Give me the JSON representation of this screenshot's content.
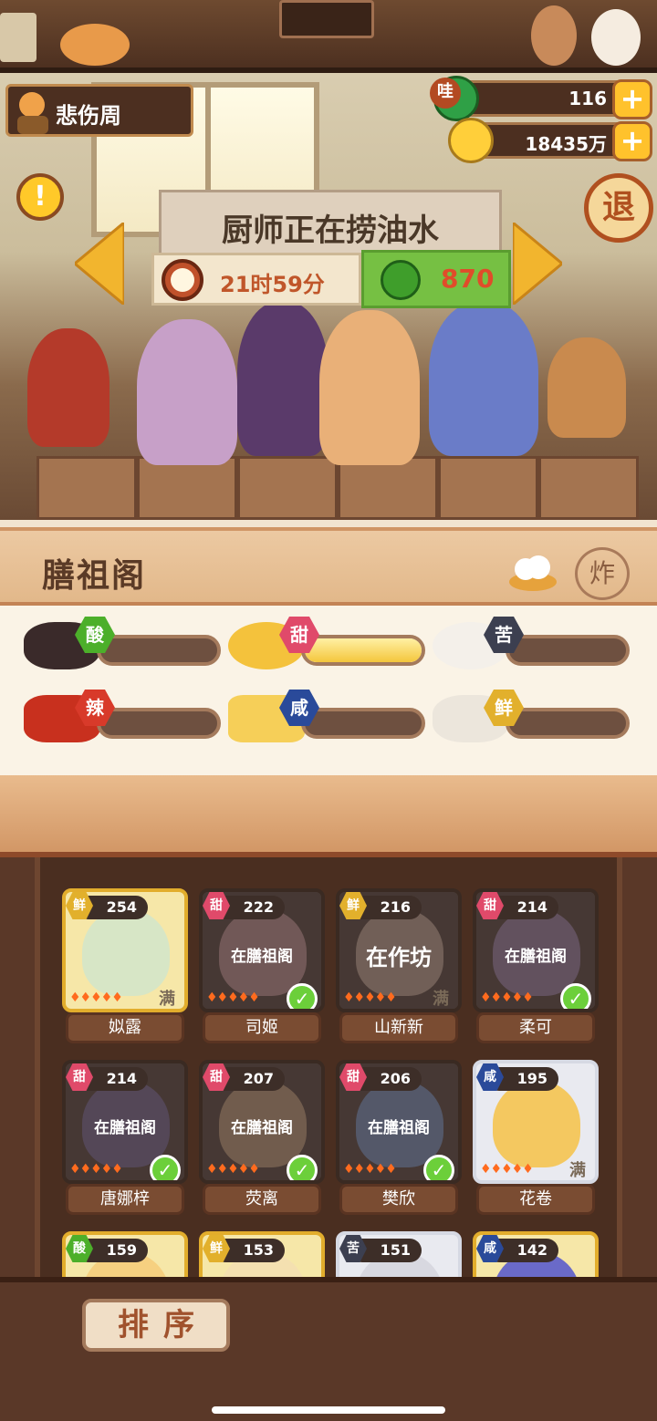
{
  "player": {
    "name": "悲伤周"
  },
  "currency": {
    "gems": "116",
    "gem_badge": "哇",
    "coins": "18435万",
    "plus": "+"
  },
  "buttons": {
    "alert": "!",
    "exit": "退",
    "blast": "炸",
    "sort": "排序"
  },
  "status": {
    "text": "厨师正在捞油水",
    "timer": "21时59分",
    "cost": "870"
  },
  "pavilion": {
    "title": "膳祖阁",
    "flavors": [
      {
        "label": "酸",
        "color": "#4caf2a",
        "fill": 0
      },
      {
        "label": "甜",
        "color": "#e04a6a",
        "fill": 1
      },
      {
        "label": "苦",
        "color": "#3c3f50",
        "fill": 0
      },
      {
        "label": "辣",
        "color": "#d83a2a",
        "fill": 0
      },
      {
        "label": "咸",
        "color": "#2a4a9a",
        "fill": 0
      },
      {
        "label": "鲜",
        "color": "#e2b02c",
        "fill": 0
      }
    ]
  },
  "chefs": [
    {
      "name": "姒露",
      "level": "254",
      "flavor": "鲜",
      "status": "",
      "badge": "满"
    },
    {
      "name": "司姬",
      "level": "222",
      "flavor": "甜",
      "status": "在膳祖阁",
      "badge": ""
    },
    {
      "name": "山新新",
      "level": "216",
      "flavor": "鲜",
      "status": "在作坊",
      "badge": "满"
    },
    {
      "name": "柔可",
      "level": "214",
      "flavor": "甜",
      "status": "在膳祖阁",
      "badge": ""
    },
    {
      "name": "唐娜梓",
      "level": "214",
      "flavor": "甜",
      "status": "在膳祖阁",
      "badge": ""
    },
    {
      "name": "荧离",
      "level": "207",
      "flavor": "甜",
      "status": "在膳祖阁",
      "badge": ""
    },
    {
      "name": "樊欣",
      "level": "206",
      "flavor": "甜",
      "status": "在膳祖阁",
      "badge": ""
    },
    {
      "name": "花卷",
      "level": "195",
      "flavor": "咸",
      "status": "",
      "badge": "满"
    },
    {
      "name": "",
      "level": "159",
      "flavor": "酸",
      "status": "",
      "badge": ""
    },
    {
      "name": "",
      "level": "153",
      "flavor": "鲜",
      "status": "",
      "badge": ""
    },
    {
      "name": "",
      "level": "151",
      "flavor": "苦",
      "status": "",
      "badge": ""
    },
    {
      "name": "",
      "level": "142",
      "flavor": "咸",
      "status": "",
      "badge": ""
    }
  ]
}
